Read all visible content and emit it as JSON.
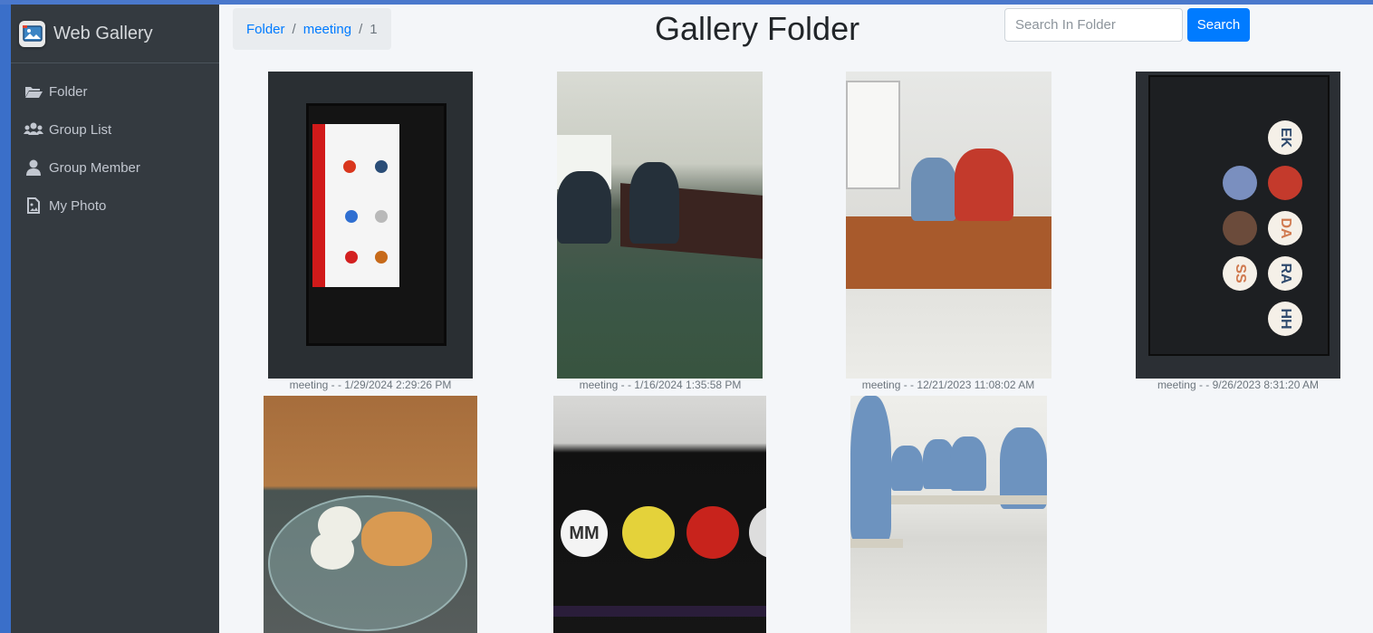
{
  "app": {
    "brand": "Web Gallery",
    "brand_icon": "gallery-image-icon"
  },
  "sidebar": {
    "items": [
      {
        "label": "Folder",
        "icon": "folder-open-icon"
      },
      {
        "label": "Group List",
        "icon": "users-icon"
      },
      {
        "label": "Group Member",
        "icon": "user-icon"
      },
      {
        "label": "My Photo",
        "icon": "file-image-icon"
      }
    ]
  },
  "breadcrumb": {
    "items": [
      "Folder",
      "meeting",
      "1"
    ]
  },
  "header": {
    "title": "Gallery Folder"
  },
  "search": {
    "placeholder": "Search In Folder",
    "value": "",
    "button_label": "Search"
  },
  "colors": {
    "sidebar_bg": "#343a40",
    "main_bg": "#f4f6f9",
    "accent": "#007bff",
    "frame": "#3a6fc9"
  },
  "photos": [
    {
      "caption": "meeting - - 1/29/2024 2:29:26 PM"
    },
    {
      "caption": "meeting - - 1/16/2024 1:35:58 PM"
    },
    {
      "caption": "meeting - - 12/21/2023 11:08:02 AM"
    },
    {
      "caption": "meeting - - 9/26/2023 8:31:20 AM",
      "avatars": [
        "EK",
        "DA",
        "SS",
        "RA",
        "HH"
      ]
    },
    {
      "caption": ""
    },
    {
      "caption": "",
      "avatars": [
        "MM"
      ]
    },
    {
      "caption": ""
    }
  ]
}
